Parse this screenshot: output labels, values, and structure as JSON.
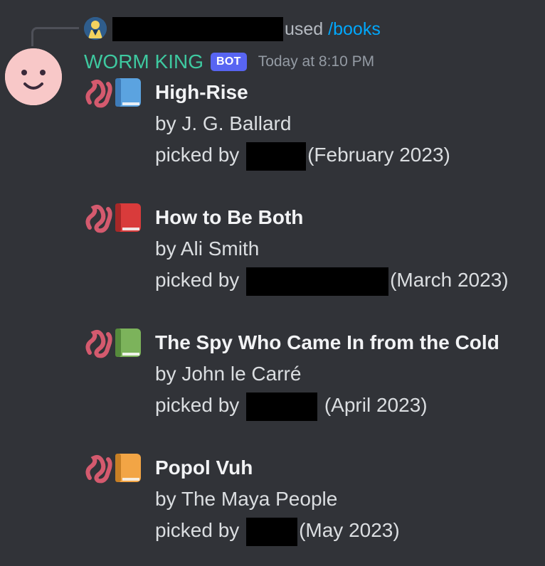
{
  "reply": {
    "used_text": "used",
    "command": "/books"
  },
  "message": {
    "username": "WORM KING",
    "bot_tag": "BOT",
    "timestamp": "Today at 8:10 PM"
  },
  "books": [
    {
      "title": "High-Rise",
      "author": "by J. G. Ballard",
      "picked_prefix": "picked by",
      "date": "(February 2023)",
      "icon_color": "#5ba3e0"
    },
    {
      "title": "How to Be Both",
      "author": "by Ali Smith",
      "picked_prefix": "picked by",
      "date": "(March 2023)",
      "icon_color": "#d93b3b"
    },
    {
      "title": "The Spy Who Came In from the Cold",
      "author": "by John le Carré",
      "picked_prefix": "picked by",
      "date": "(April 2023)",
      "icon_color": "#7cb35b"
    },
    {
      "title": "Popol Vuh",
      "author": "by The Maya People",
      "picked_prefix": "picked by",
      "date": "(May 2023)",
      "icon_color": "#f2a545"
    }
  ],
  "colors": {
    "background": "#313338",
    "username": "#3ec9a0",
    "bot_tag": "#5865f2",
    "command": "#00a8fc",
    "timestamp": "#949ba4"
  }
}
